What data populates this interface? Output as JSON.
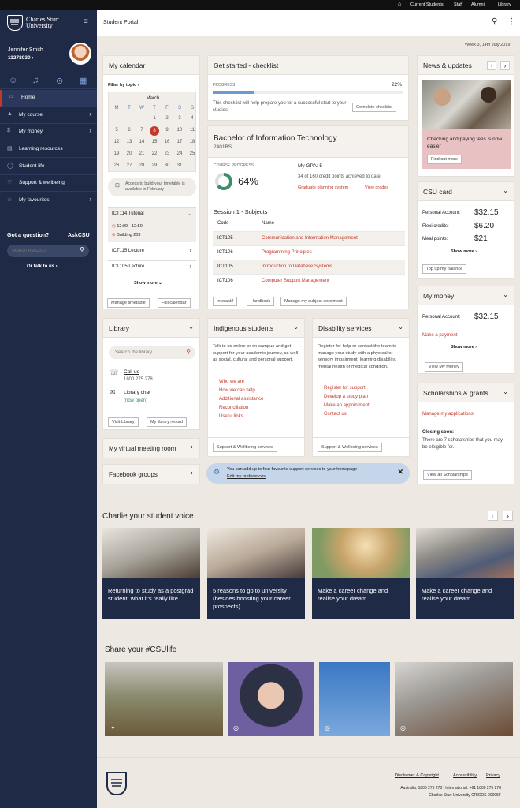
{
  "topbar": {
    "links": [
      "Current Students",
      "Staff",
      "Alumni",
      "Library"
    ]
  },
  "brand": {
    "name_line1": "Charles Sturt",
    "name_line2": "University"
  },
  "user": {
    "name": "Jennifer Smith",
    "id": "11278030"
  },
  "sidebar": {
    "items": [
      {
        "label": "Home",
        "icon": "home-icon"
      },
      {
        "label": "My course",
        "icon": "graduation-cap-icon"
      },
      {
        "label": "My money",
        "icon": "dollar-icon"
      },
      {
        "label": "Learning resources",
        "icon": "book-icon"
      },
      {
        "label": "Student life",
        "icon": "globe-icon"
      },
      {
        "label": "Support & wellbeing",
        "icon": "heart-icon"
      },
      {
        "label": "My favourites",
        "icon": "star-icon"
      }
    ],
    "question": "Got a question?",
    "askcsu": "AskCSU",
    "search_placeholder": "Search AskCSU",
    "talk": "Or talk to us"
  },
  "header": {
    "title": "Student Portal"
  },
  "date": "Week 3, 14th July 2019",
  "calendar": {
    "title": "My calendar",
    "filter": "Filter by topic",
    "month": "March",
    "days": [
      "M",
      "T",
      "W",
      "T",
      "F",
      "S",
      "S"
    ],
    "weeks": [
      [
        "",
        "",
        "",
        "1",
        "2",
        "3",
        "4"
      ],
      [
        "5",
        "6",
        "7",
        "8",
        "9",
        "10",
        "11"
      ],
      [
        "12",
        "13",
        "14",
        "15",
        "16",
        "17",
        "18"
      ],
      [
        "19",
        "20",
        "21",
        "22",
        "23",
        "24",
        "25"
      ],
      [
        "26",
        "27",
        "28",
        "29",
        "30",
        "31",
        ""
      ]
    ],
    "today": "8",
    "notice": "Access to build your timetable is available in February",
    "events": [
      {
        "title": "ICT114 Tutorial",
        "time": "12:00 - 12:50",
        "place": "Building 203"
      },
      {
        "title": "ICT115 Lecture"
      },
      {
        "title": "ICT105 Lecture"
      }
    ],
    "show_more": "Show more",
    "manage": "Manage timetable",
    "full": "Full calendar"
  },
  "checklist": {
    "title": "Get started - checklist",
    "progress_label": "PROGRESS",
    "progress": "22%",
    "progress_value": 0.22,
    "text": "This checklist will help prepare you for a successful start to your studies.",
    "button": "Complete checklist"
  },
  "course": {
    "title": "Bachelor of Information Technology",
    "code": "2401BS",
    "progress_label": "COURSE PROGRESS",
    "progress": "64%",
    "progress_value": 0.64,
    "gpa": "My GPA: 5",
    "credits": "34 of 160 credit points achieved to date",
    "planning": "Graduate planning system",
    "grades": "View grades",
    "session": "Session 1 - Subjects",
    "col_code": "Code",
    "col_name": "Name",
    "subjects": [
      {
        "code": "ICT105",
        "name": "Communication and Information Management"
      },
      {
        "code": "ICT106",
        "name": "Programming Principles"
      },
      {
        "code": "ICT105",
        "name": "Introduction to Database Systems"
      },
      {
        "code": "ICT106",
        "name": "Computer Support Management"
      }
    ],
    "buttons": [
      "Interact2",
      "Handbook",
      "Manage my subject enrolment"
    ]
  },
  "news": {
    "title": "News & updates",
    "headline": "Checking and paying fees is now easier",
    "button": "Find out more"
  },
  "csucard": {
    "title": "CSU card",
    "rows": [
      {
        "label": "Personal Account:",
        "value": "$32.15"
      },
      {
        "label": "Flexi credits:",
        "value": "$6.20"
      },
      {
        "label": "Meal points:",
        "value": "$21"
      }
    ],
    "show_more": "Show more",
    "button": "Top up my balance"
  },
  "money": {
    "title": "My money",
    "label": "Personal Account:",
    "value": "$32.15",
    "link": "Make a payment",
    "show_more": "Show more",
    "button": "View My Money"
  },
  "scholarships": {
    "title": "Scholarships & grants",
    "link": "Manage my applications",
    "closing": "Closing soon:",
    "text": "There are 7 scholarships that you may be eleigible for.",
    "button": "View all Scholarships"
  },
  "library": {
    "title": "Library",
    "search_placeholder": "Search the library",
    "contact": "Call us",
    "phone": "1800 275 278",
    "chat": "Library chat",
    "chat_status": "(now open)",
    "buttons": [
      "Visit Library",
      "My library record"
    ]
  },
  "indigenous": {
    "title": "Indigenous students",
    "text": "Talk to us online or on campus and get support for your academic journey, as well as social, cultural and personal support.",
    "links": [
      "Who we are",
      "How we can help",
      "Additional assistance",
      "Reconciliation",
      "Useful links"
    ],
    "button": "Support & Wellbeing services"
  },
  "disability": {
    "title": "Disability services",
    "text": "Register for help or contact the team to manage your study with a physical or sensory impairment, learning disability, mental health or medical condition.",
    "links": [
      "Register for support",
      "Develop a study plan",
      "Make an appointment",
      "Contact us"
    ],
    "button": "Support & Wellbeing services"
  },
  "meeting": {
    "title": "My virtual meeting room"
  },
  "facebook": {
    "title": "Facebook groups"
  },
  "favourite_notice": {
    "text": "You can add up to four favourite support services to your homepage",
    "link": "Edit my preferences"
  },
  "stories": {
    "title": "Charlie your student voice",
    "items": [
      "Returning to study as a postgrad student: what it's really like",
      "5 reasons to go to university (besides boosting your career prospects)",
      "Make a career change and realise your dream",
      "Make a career change and realise your dream"
    ]
  },
  "share": {
    "title": "Share your #CSUlife"
  },
  "footer": {
    "links": [
      "Disclaimer & Copyright",
      "Accessibility",
      "Privacy"
    ],
    "phones": "Australia: 1800 275 278 | International: +61 1800 275 278",
    "cricos": "Charles Sturt University CRICOS 00005F"
  },
  "colors": {
    "navy": "#1f2a47",
    "accent": "#c0392b",
    "progress": "#6d9bd1",
    "ring": "#3d8c6a"
  }
}
